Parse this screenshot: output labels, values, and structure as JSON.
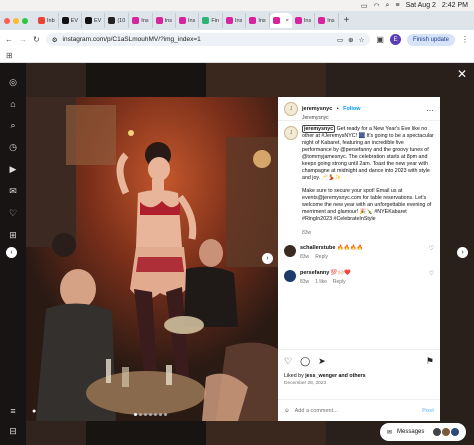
{
  "menubar": {
    "date": "Sat Aug 2",
    "time": "2:42 PM"
  },
  "tabs": [
    {
      "label": "Inb",
      "color": "#ea4335",
      "active": false
    },
    {
      "label": "EV",
      "color": "#111111",
      "active": false
    },
    {
      "label": "EV",
      "color": "#111111",
      "active": false
    },
    {
      "label": "(10",
      "color": "#222222",
      "active": false
    },
    {
      "label": "Ins",
      "color": "#d6249f",
      "active": false
    },
    {
      "label": "Ins",
      "color": "#d6249f",
      "active": false
    },
    {
      "label": "Ins",
      "color": "#d6249f",
      "active": false
    },
    {
      "label": "Fin",
      "color": "#2bb673",
      "active": false
    },
    {
      "label": "Ins",
      "color": "#d6249f",
      "active": false
    },
    {
      "label": "Ins",
      "color": "#d6249f",
      "active": false
    },
    {
      "label": "",
      "color": "#d6249f",
      "active": true
    },
    {
      "label": "Ins",
      "color": "#d6249f",
      "active": false
    },
    {
      "label": "Ins",
      "color": "#d6249f",
      "active": false
    }
  ],
  "address": {
    "url": "instagram.com/p/C1aSLmouhMV/?img_index=1",
    "profile_initial": "E",
    "finish_update": "Finish update"
  },
  "post": {
    "username": "jeremysnyc",
    "follow": "Follow",
    "subtitle": "Jeremysnyc",
    "caption_mention": "jeremysnyc",
    "caption_p1": " Get ready for a New Year's Eve like no other at #JeremysNYC! 🎆 It's going to be a spectacular night of Kabaret, featuring an incredible live performance by @persefanny and the groovy tunes of @tommyjamesnyc. The celebration starts at 8pm and keeps going strong until 2am. Toast the new year with champagne at midnight and dance into 2023 with style and joy. 🥂💃✨",
    "caption_p2": "Make sure to secure your spot! Email us at events@jeremysnyc.com for table reservations. Let's welcome the new year with an unforgettable evening of merriment and glamour! 🎉🍾 #NYEKabaret #RingIn2023 #CelebrateInStyle",
    "caption_age": "83w",
    "comments": [
      {
        "user": "schallerstube",
        "text": "🔥🔥🔥🔥",
        "age": "83w",
        "reply": "Reply",
        "likes": ""
      },
      {
        "user": "persefanny",
        "text": "💯🙌🏻❤️",
        "age": "83w",
        "reply": "Reply",
        "likes": "1 like"
      }
    ],
    "liked_by_prefix": "Liked by ",
    "liked_by_user": "jess_wenger",
    "liked_by_suffix": " and others",
    "date": "December 28, 2023",
    "add_comment_placeholder": "Add a comment...",
    "post_label": "Post"
  },
  "messages": {
    "label": "Messages"
  }
}
